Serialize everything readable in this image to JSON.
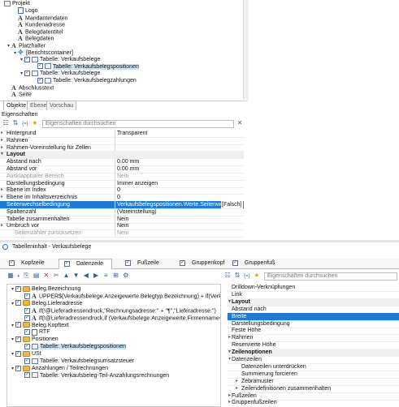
{
  "tree1": {
    "root": "Projekt",
    "items": [
      "Logo",
      "Mandantendaten",
      "Kundenadresse",
      "Belegdatentitel",
      "Belegdaten",
      "Platzhalter",
      "[Berichtscontainer]",
      "Tabelle: Verkaufsbelege",
      "Tabelle: Verkaufsbelegspositionen",
      "Tabelle: Verkaufsbelege",
      "Tabelle: Verkaufsbelegzahlungen",
      "Abschlusstext",
      "Seite"
    ]
  },
  "bottom_tabs": [
    "Objekte",
    "Ebenen",
    "Vorschau"
  ],
  "props": {
    "title": "Eigenschaften",
    "search_placeholder": "Eigenschaften durchsuchen",
    "rows": [
      {
        "name": "Hintergrund",
        "value": "Transparent"
      },
      {
        "name": "Rahmen",
        "value": ""
      },
      {
        "name": "Rahmen-Voreinstellung für Zellen",
        "value": ""
      },
      {
        "name": "Layout",
        "value": ""
      },
      {
        "name": "Abstand nach",
        "value": "0.00 mm"
      },
      {
        "name": "Abstand vor",
        "value": "0.00 mm"
      },
      {
        "name": "Ausklappbarer Bereich",
        "value": "Nein"
      },
      {
        "name": "Darstellungsbedingung",
        "value": "Immer anzeigen"
      },
      {
        "name": "Ebene im Index",
        "value": "0"
      },
      {
        "name": "Ebene im Inhaltsverzeichnis",
        "value": "0"
      },
      {
        "name": "Seitenwechselbedingung",
        "value": "Verkaufsbelegspositionen.Werte.Seitenwechsel",
        "extra": "[Falsch]"
      },
      {
        "name": "Spaltenzahl",
        "value": "(Voreinstellung)"
      },
      {
        "name": "Tabelle zusammenhalten",
        "value": "Nein"
      },
      {
        "name": "Umbruch vor",
        "value": "Nein"
      },
      {
        "name": "Seitenzähler zurücksetzen",
        "value": "Nein"
      }
    ]
  },
  "dialog": {
    "title": "Tabelleninhalt - Verkaufsbelege",
    "tabs": [
      "Kopfzeile",
      "Datenzeile",
      "Fußzeile",
      "Gruppenkopf",
      "Gruppenfuß"
    ],
    "tree": [
      {
        "label": "Beleg.Bezeichnung",
        "kind": "folder",
        "level": 1
      },
      {
        "label": "UPPER$(Verkaufsbelege.Anzeigewerte.Belegtyp.Bezeichnung) + if(Verkaufsbelege.Werte.",
        "kind": "a",
        "level": 2
      },
      {
        "label": "Beleg.Lieferadresse",
        "kind": "folder",
        "level": 1
      },
      {
        "label": "if(!@Lieferadressendruck,\"Rechnungsadresse:\" + \"¶\",\"Lieferadresse:\")",
        "kind": "a",
        "level": 2
      },
      {
        "label": "if(!@Lieferadressendruck,if (Verkaufsbelege.Anzeigewerte.Firmenname<>\"\",if(Verkaufsbelege",
        "kind": "a",
        "level": 2
      },
      {
        "label": "Beleg.Kopftext",
        "kind": "folder",
        "level": 1
      },
      {
        "label": "RTF",
        "kind": "doc",
        "level": 2
      },
      {
        "label": "Positionen",
        "kind": "folder",
        "level": 1
      },
      {
        "label": "Tabelle: Verkaufsbelegspositionen",
        "kind": "box",
        "level": 2
      },
      {
        "label": "USt",
        "kind": "folder",
        "level": 1
      },
      {
        "label": "Tabelle: Verkaufsbelegsumsatzsteuer",
        "kind": "box",
        "level": 2
      },
      {
        "label": "Anzahlungen / Teilrechnungen",
        "kind": "folder",
        "level": 1
      },
      {
        "label": "Tabelle: Verkaufsbeleg-Teil-Anzahlungsrechnungen",
        "kind": "box",
        "level": 2
      }
    ],
    "search_placeholder": "Eigenschaften durchsuchen",
    "props": [
      {
        "name": "Drilldown-Verknüpfungen",
        "type": "row"
      },
      {
        "name": "Link",
        "type": "row"
      },
      {
        "name": "Layout",
        "type": "cat"
      },
      {
        "name": "Abstand nach",
        "type": "row"
      },
      {
        "name": "Breite",
        "type": "sel"
      },
      {
        "name": "Darstellungsbedingung",
        "type": "row"
      },
      {
        "name": "Feste Höhe",
        "type": "row"
      },
      {
        "name": "Rahmen",
        "type": "row"
      },
      {
        "name": "Reservierte Höhe",
        "type": "row"
      },
      {
        "name": "Zeilenoptionen",
        "type": "cat"
      },
      {
        "name": "Datenzeilen",
        "type": "row"
      },
      {
        "name": "Datenzeilen unterdrücken",
        "type": "sub"
      },
      {
        "name": "Summierung forcieren",
        "type": "sub"
      },
      {
        "name": "Zebramuster",
        "type": "sub"
      },
      {
        "name": "Zeilendefinitionen zusammenhalten",
        "type": "sub"
      },
      {
        "name": "Fußzeilen",
        "type": "row"
      },
      {
        "name": "Gruppenfußzeilen",
        "type": "row"
      }
    ]
  }
}
